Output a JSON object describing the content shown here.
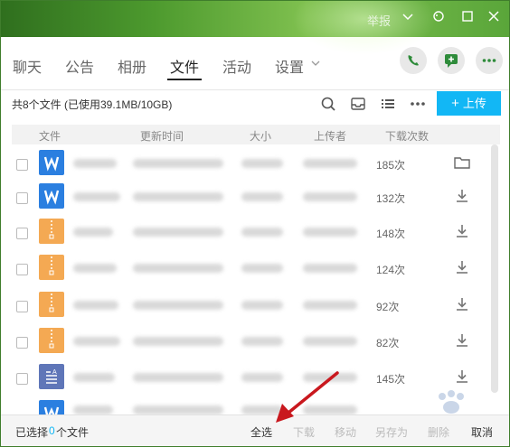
{
  "window": {
    "report_label": "举报"
  },
  "tabs": [
    {
      "label": "聊天",
      "active": false
    },
    {
      "label": "公告",
      "active": false
    },
    {
      "label": "相册",
      "active": false
    },
    {
      "label": "文件",
      "active": true
    },
    {
      "label": "活动",
      "active": false
    },
    {
      "label": "设置",
      "active": false
    }
  ],
  "toolbar": {
    "summary": "共8个文件 (已使用39.1MB/10GB)",
    "upload_label": "上传"
  },
  "columns": {
    "file": "文件",
    "time": "更新时间",
    "size": "大小",
    "uploader": "上传者",
    "downloads": "下载次数"
  },
  "files": [
    {
      "type": "word",
      "downloads": "185次",
      "action": "folder-icon"
    },
    {
      "type": "word",
      "downloads": "132次",
      "action": "download-icon"
    },
    {
      "type": "zip",
      "downloads": "148次",
      "action": "download-icon"
    },
    {
      "type": "zip",
      "downloads": "124次",
      "action": "download-icon"
    },
    {
      "type": "zip",
      "downloads": "92次",
      "action": "download-icon"
    },
    {
      "type": "zip",
      "downloads": "82次",
      "action": "download-icon"
    },
    {
      "type": "doc",
      "downloads": "145次",
      "action": "download-icon"
    },
    {
      "type": "word",
      "downloads": "",
      "action": ""
    }
  ],
  "footer": {
    "selected_prefix": "已选择",
    "selected_count": "0",
    "selected_suffix": "个文件",
    "select_all": "全选",
    "download": "下载",
    "move": "移动",
    "save_as": "另存为",
    "delete": "删除",
    "cancel": "取消"
  },
  "colors": {
    "accent": "#12b7f5",
    "selected_count": "#12b7f5"
  }
}
